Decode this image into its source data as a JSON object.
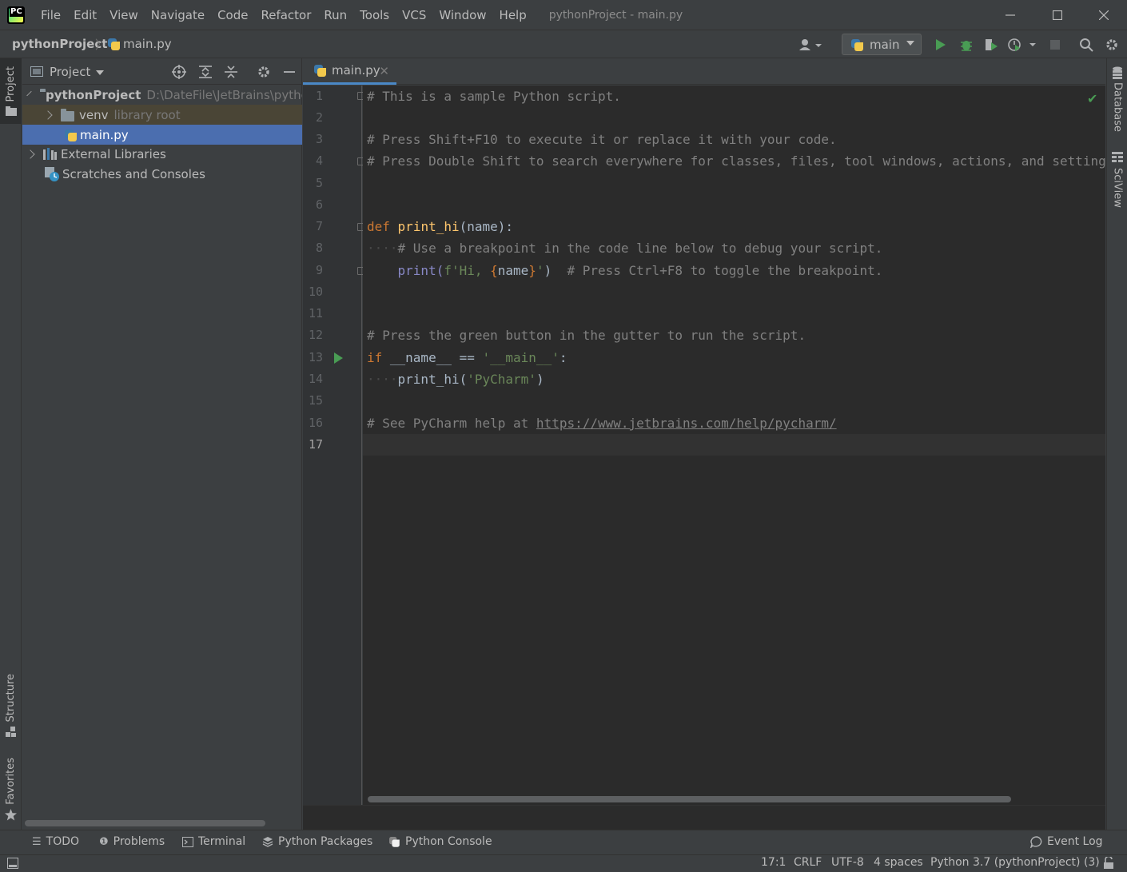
{
  "menubar": {
    "app_logo_text": "PC",
    "items": [
      "File",
      "Edit",
      "View",
      "Navigate",
      "Code",
      "Refactor",
      "Run",
      "Tools",
      "VCS",
      "Window",
      "Help"
    ],
    "window_title": "pythonProject - main.py"
  },
  "navbar": {
    "project": "pythonProject",
    "file": "main.py",
    "run_config": "main"
  },
  "left_strip": {
    "project_tab": "Project",
    "structure_tab": "Structure",
    "favorites_tab": "Favorites"
  },
  "right_strip": {
    "database_tab": "Database",
    "sciview_tab": "SciView"
  },
  "project_panel": {
    "title": "Project",
    "tree": [
      {
        "label": "pythonProject",
        "sub": "D:\\DateFile\\JetBrains\\python"
      },
      {
        "label": "venv",
        "sub": "library root"
      },
      {
        "label": "main.py",
        "sub": ""
      },
      {
        "label": "External Libraries",
        "sub": ""
      },
      {
        "label": "Scratches and Consoles",
        "sub": ""
      }
    ]
  },
  "editor": {
    "tab_label": "main.py",
    "line_numbers": [
      "1",
      "2",
      "3",
      "4",
      "5",
      "6",
      "7",
      "8",
      "9",
      "10",
      "11",
      "12",
      "13",
      "14",
      "15",
      "16",
      "17"
    ],
    "current_line": "17",
    "code": {
      "l1": "# This is a sample Python script.",
      "l3": "# Press Shift+F10 to execute it or replace it with your code.",
      "l4": "# Press Double Shift to search everywhere for classes, files, tool windows, actions, and settings.",
      "l7_kw": "def",
      "l7_fn": "print_hi",
      "l7_rest": "(name):",
      "l8": "# Use a breakpoint in the code line below to debug your script.",
      "l9_call": "print(",
      "l9_str1": "f'Hi, ",
      "l9_brace_open": "{",
      "l9_var": "name",
      "l9_brace_close": "}",
      "l9_str2": "'",
      "l9_close": ")",
      "l9_comment": "# Press Ctrl+F8 to toggle the breakpoint.",
      "l12": "# Press the green button in the gutter to run the script.",
      "l13_kw": "if",
      "l13_mid": " __name__ == ",
      "l13_str": "'__main__'",
      "l13_end": ":",
      "l14_call": "print_hi(",
      "l14_str": "'PyCharm'",
      "l14_end": ")",
      "l16_prefix": "# See PyCharm help at ",
      "l16_link": "https://www.jetbrains.com/help/pycharm/"
    }
  },
  "bottom_tabs": [
    "TODO",
    "Problems",
    "Terminal",
    "Python Packages",
    "Python Console"
  ],
  "event_log": "Event Log",
  "status": {
    "position": "17:1",
    "line_sep": "CRLF",
    "encoding": "UTF-8",
    "indent": "4 spaces",
    "interpreter": "Python 3.7 (pythonProject) (3)"
  },
  "colors": {
    "accent": "#4b6eaf",
    "run_green": "#499c54",
    "keyword": "#cc7832",
    "function": "#ffc66d",
    "string": "#6a8759",
    "comment": "#808080"
  }
}
